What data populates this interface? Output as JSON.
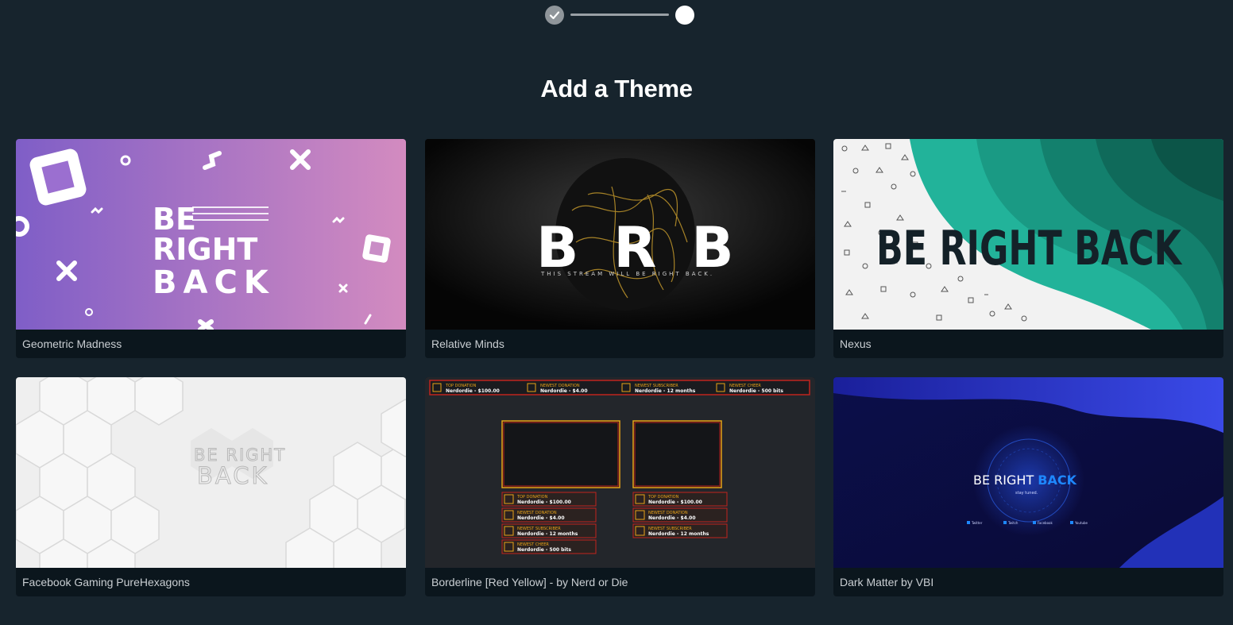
{
  "stepper": {
    "steps_total": 2,
    "current_step": 2
  },
  "title": "Add a Theme",
  "themes": [
    {
      "name": "Geometric Madness",
      "preview": {
        "line1": "BE",
        "line2": "RIGHT",
        "line3": "BACK"
      }
    },
    {
      "name": "Relative Minds",
      "preview": {
        "letters": "BRB",
        "tagline": "THIS STREAM WILL BE RIGHT BACK."
      }
    },
    {
      "name": "Nexus",
      "preview": {
        "text": "BE RIGHT BACK"
      }
    },
    {
      "name": "Facebook Gaming PureHexagons",
      "preview": {
        "line1": "BE RIGHT",
        "line2": "BACK"
      }
    },
    {
      "name": "Borderline [Red Yellow] - by Nerd or Die",
      "preview": {
        "alerts": [
          {
            "label": "TOP DONATION",
            "value": "Nerdordie - $100.00"
          },
          {
            "label": "NEWEST DONATION",
            "value": "Nerdordie - $4.00"
          },
          {
            "label": "NEWEST SUBSCRIBER",
            "value": "Nerdordie - 12 months"
          },
          {
            "label": "NEWEST CHEER",
            "value": "Nerdordie - 500 bits"
          }
        ]
      }
    },
    {
      "name": "Dark Matter by VBI",
      "preview": {
        "text_main": "BE RIGHT ",
        "text_accent": "BACK",
        "subtitle": "stay tuned.",
        "socials": [
          "Twitter",
          "Twitch",
          "Facebook",
          "Youtube"
        ]
      }
    }
  ],
  "colors": {
    "background": "#17242d",
    "card": "#0b161d",
    "borderline_red": "#c0241e",
    "borderline_yellow": "#e8a317",
    "nexus_teal": "#22b39a",
    "dark_matter_accent": "#1e88ff"
  }
}
